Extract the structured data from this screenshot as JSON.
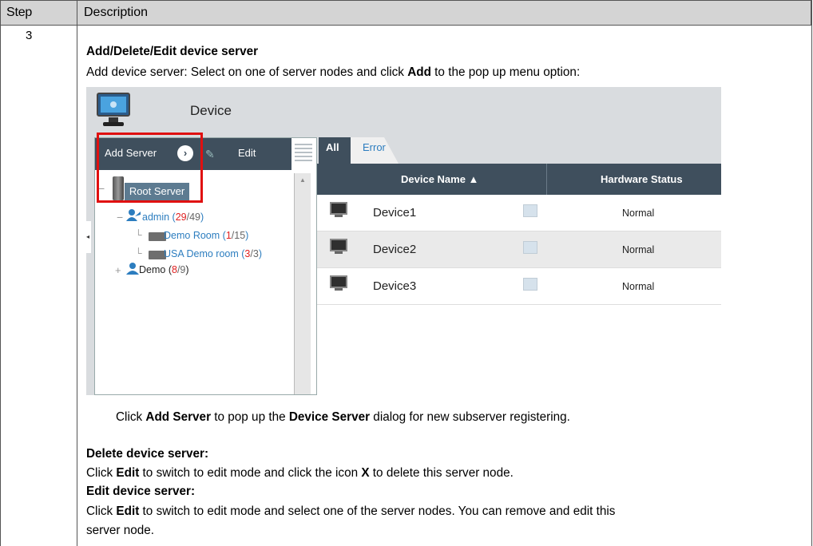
{
  "table": {
    "header_step": "Step",
    "header_description": "Description",
    "step_number": "3"
  },
  "content": {
    "heading": "Add/Delete/Edit device server",
    "add_intro_prefix": "Add device server: Select on one of server nodes and click ",
    "add_intro_bold": "Add",
    "add_intro_suffix": " to the pop up menu option:",
    "click_line_prefix": "Click ",
    "click_line_bold1": "Add Server",
    "click_line_mid": " to pop up the ",
    "click_line_bold2": "Device Server",
    "click_line_suffix": " dialog for new subserver registering.",
    "delete_heading": "Delete device server:",
    "delete_prefix": "Click ",
    "delete_bold1": "Edit",
    "delete_mid": " to switch to edit mode and click the icon ",
    "delete_bold2": "X",
    "delete_suffix": " to delete this server node.",
    "edit_heading": "Edit device server:",
    "edit_prefix": "Click ",
    "edit_bold": "Edit",
    "edit_suffix": " to switch to edit mode and select one of the server nodes. You can remove and edit this",
    "edit_line2": "server node."
  },
  "screenshot": {
    "title": "Device",
    "toolbar": {
      "add_server": "Add Server",
      "edit": "Edit"
    },
    "tree": {
      "root": "Root Server",
      "admin": {
        "label": "admin",
        "online": "29",
        "total": "/49"
      },
      "demo_room": {
        "label": "Demo Room",
        "online": "1",
        "total": "/15"
      },
      "usa_room": {
        "label": "USA Demo room",
        "online": "3",
        "total": "/3"
      },
      "demo": {
        "label": "Demo",
        "online": "8",
        "total": "/9"
      }
    },
    "tabs": {
      "all": "All",
      "error": "Error"
    },
    "columns": {
      "device_name": "Device Name ▲",
      "hardware_status": "Hardware Status"
    },
    "rows": [
      {
        "name": "Device1",
        "status": "Normal"
      },
      {
        "name": "Device2",
        "status": "Normal"
      },
      {
        "name": "Device3",
        "status": "Normal"
      }
    ]
  }
}
